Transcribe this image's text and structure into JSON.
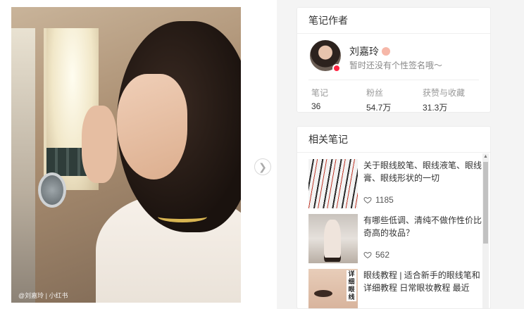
{
  "photo": {
    "watermark": "@刘嘉玲 | 小红书",
    "next_icon": "chevron-right-icon"
  },
  "author_card": {
    "title": "笔记作者",
    "name": "刘嘉玲",
    "bio": "暂时还没有个性签名哦～",
    "stats": [
      {
        "label": "笔记",
        "value": "36"
      },
      {
        "label": "粉丝",
        "value": "54.7万"
      },
      {
        "label": "获赞与收藏",
        "value": "31.3万"
      }
    ]
  },
  "related_card": {
    "title": "相关笔记",
    "notes": [
      {
        "title": "关于眼线胶笔、眼线液笔、眼线膏、眼线形状的一切",
        "likes": "1185"
      },
      {
        "title": "有哪些低调、清纯不做作性价比奇高的妆品？",
        "likes": "562"
      },
      {
        "title": "眼线教程 | 适合新手的眼线笔和详细教程 日常眼妆教程 最近",
        "likes": "",
        "thumb_text": "详细眼线"
      }
    ]
  },
  "colors": {
    "brand": "#ff2442",
    "text": "#333333",
    "muted": "#999999"
  }
}
